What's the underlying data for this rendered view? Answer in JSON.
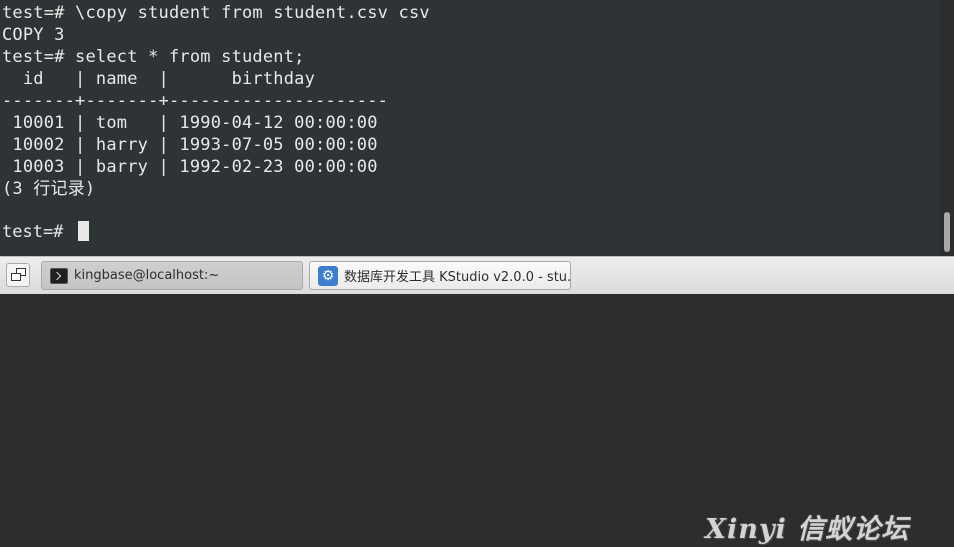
{
  "terminal": {
    "lines": [
      "test=# \\copy student from student.csv csv",
      "COPY 3",
      "test=# select * from student;",
      "  id   | name  |      birthday",
      "-------+-------+---------------------",
      " 10001 | tom   | 1990-04-12 00:00:00",
      " 10002 | harry | 1993-07-05 00:00:00",
      " 10003 | barry | 1992-02-23 00:00:00",
      "(3 行记录)",
      ""
    ],
    "prompt": "test=# "
  },
  "taskbar": {
    "show_desktop_icon": "show-desktop-icon",
    "tasks": [
      {
        "label": "kingbase@localhost:~",
        "icon": "terminal-icon",
        "active": true
      },
      {
        "label": "数据库开发工具 KStudio v2.0.0 - stu...",
        "icon": "kstudio-icon",
        "active": false
      }
    ]
  },
  "watermark": {
    "text": "Xinyi 信蚁论坛"
  },
  "colors": {
    "terminal_bg": "#2e3436",
    "terminal_fg": "#e8e8e8",
    "taskbar_bg": "#e6e6e6"
  }
}
